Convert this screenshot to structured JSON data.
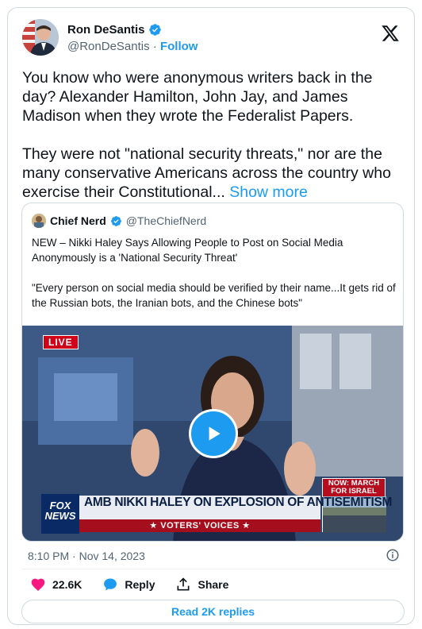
{
  "author": {
    "name": "Ron DeSantis",
    "handle": "@RonDeSantis",
    "separator": "·",
    "follow_label": "Follow"
  },
  "tweet": {
    "text": "You know who were anonymous writers back in the day? Alexander Hamilton, John Jay, and James Madison when they wrote the Federalist Papers.\n\nThey were not \"national security threats,\" nor are the many conservative Americans across the country who exercise their Constitutional...",
    "show_more_label": "Show more"
  },
  "quoted_tweet": {
    "name": "Chief Nerd",
    "handle": "@TheChiefNerd",
    "text": "NEW – Nikki Haley Says Allowing People to Post on Social Media Anonymously is a 'National Security Threat'\n\n\"Every person on social media should be verified by their name...It gets rid of the Russian bots, the Iranian bots, and the Chinese bots\"",
    "video": {
      "live_badge": "LIVE",
      "network_logo": "FOX NEWS",
      "headline": "AMB NIKKI HALEY ON EXPLOSION OF ANTISEMITISM",
      "ticker": "★ VOTERS' VOICES ★",
      "inset_label": "NOW: MARCH FOR ISRAEL"
    }
  },
  "meta": {
    "timestamp": "8:10 PM · Nov 14, 2023"
  },
  "actions": {
    "likes": "22.6K",
    "reply_label": "Reply",
    "share_label": "Share",
    "read_replies_label": "Read 2K replies"
  },
  "colors": {
    "accent": "#1d9bf0",
    "like": "#f91880",
    "muted": "#536471",
    "border": "#cfd9de"
  },
  "icons": {
    "verified": "verified-badge-icon",
    "logo": "x-logo-icon",
    "play": "play-icon",
    "info": "info-icon",
    "like": "heart-icon",
    "reply": "reply-bubble-icon",
    "share": "share-upload-icon"
  }
}
